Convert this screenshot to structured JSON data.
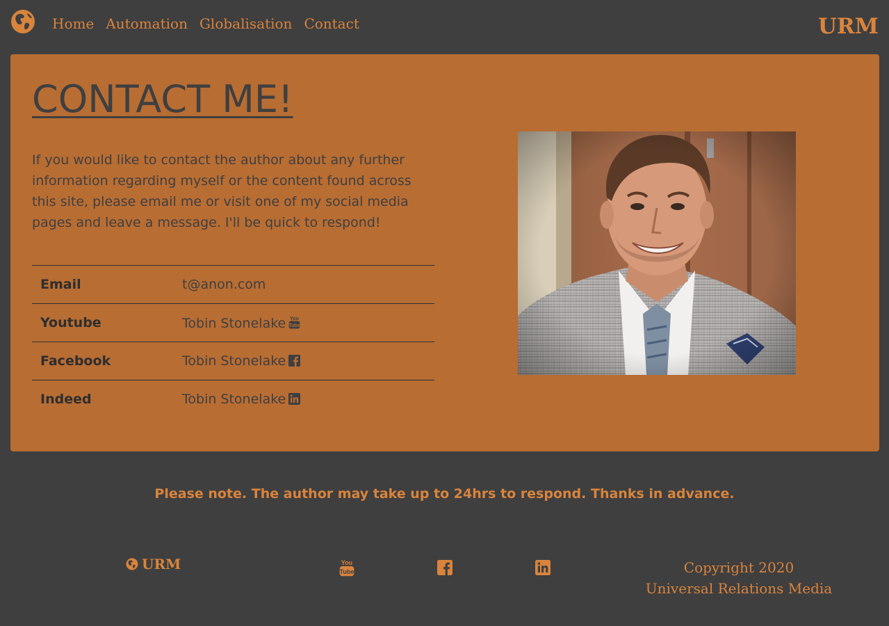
{
  "nav": {
    "links": [
      "Home",
      "Automation",
      "Globalisation",
      "Contact"
    ],
    "brand": "URM"
  },
  "contact": {
    "title": "CONTACT ME!",
    "intro": "If you would like to contact the author about any further information regarding myself or the content found across this site, please email me or visit one of my social media pages and leave a message. I'll be quick to respond!",
    "rows": [
      {
        "label": "Email",
        "value": "t@anon.com",
        "icon": null
      },
      {
        "label": "Youtube",
        "value": "Tobin Stonelake",
        "icon": "youtube-icon"
      },
      {
        "label": "Facebook",
        "value": "Tobin Stonelake",
        "icon": "facebook-icon"
      },
      {
        "label": "Indeed",
        "value": "Tobin Stonelake",
        "icon": "linkedin-icon"
      }
    ],
    "photo_icon": "profile-photo"
  },
  "note": "Please note. The author may take up to 24hrs to respond. Thanks in advance.",
  "footer": {
    "brand": "URM",
    "social_icons": [
      "youtube-icon",
      "facebook-icon",
      "linkedin-icon"
    ],
    "copyright_line1": "Copyright 2020",
    "copyright_line2": "Universal Relations Media"
  },
  "colors": {
    "background": "#3f3f40",
    "accent": "#d9843c",
    "card": "#b86d33",
    "text_dark": "#3f3f40"
  }
}
